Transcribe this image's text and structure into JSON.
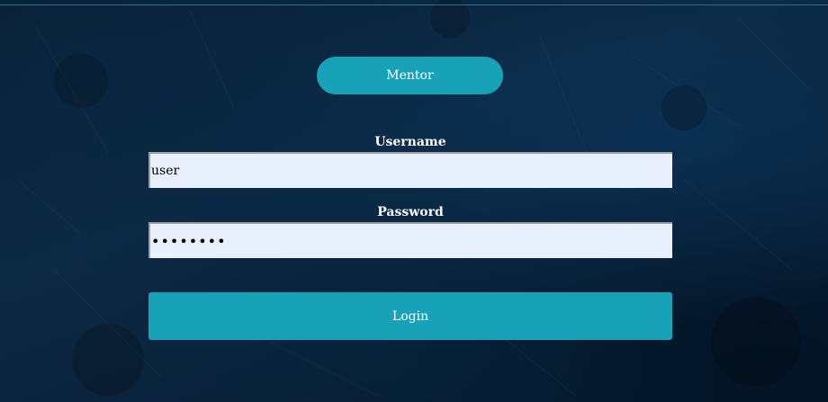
{
  "header": {
    "mentor_label": "Mentor"
  },
  "form": {
    "username_label": "Username",
    "username_value": "user",
    "password_label": "Password",
    "password_value": "••••••••",
    "login_label": "Login"
  },
  "colors": {
    "accent": "#17a2b8",
    "input_background": "#e8f0fe",
    "page_background": "#0d2a45"
  }
}
